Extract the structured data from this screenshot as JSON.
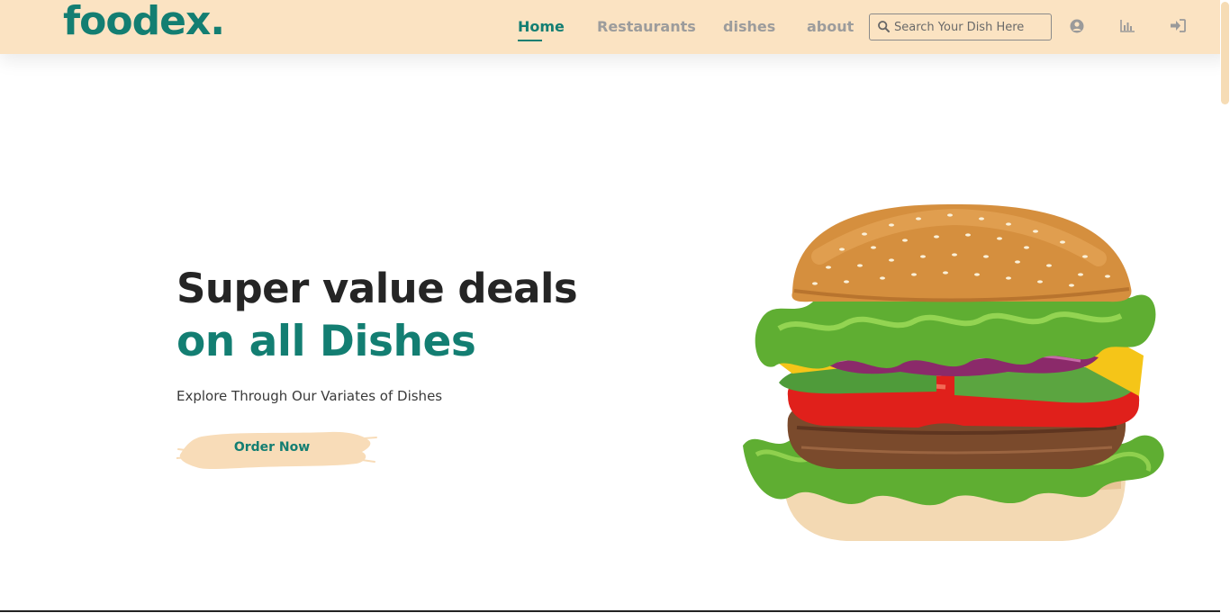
{
  "brand": {
    "logo_text": "foodex.",
    "color": "#137e72"
  },
  "nav": {
    "links": [
      "Home",
      "Restaurants",
      "dishes",
      "about"
    ],
    "active": "Home",
    "search_placeholder": "Search Your Dish Here",
    "icons": [
      "user-circle-icon",
      "chart-icon",
      "sign-in-icon"
    ]
  },
  "hero": {
    "headline_line1": "Super value deals",
    "headline_line2": "on all Dishes",
    "tagline": "Explore Through Our Variates of Dishes",
    "cta_label": "Order Now",
    "image": "burger-image"
  },
  "colors": {
    "nav_bg": "#fbe3c2",
    "accent": "#137e72",
    "cta_bg": "#f8dcb8"
  }
}
